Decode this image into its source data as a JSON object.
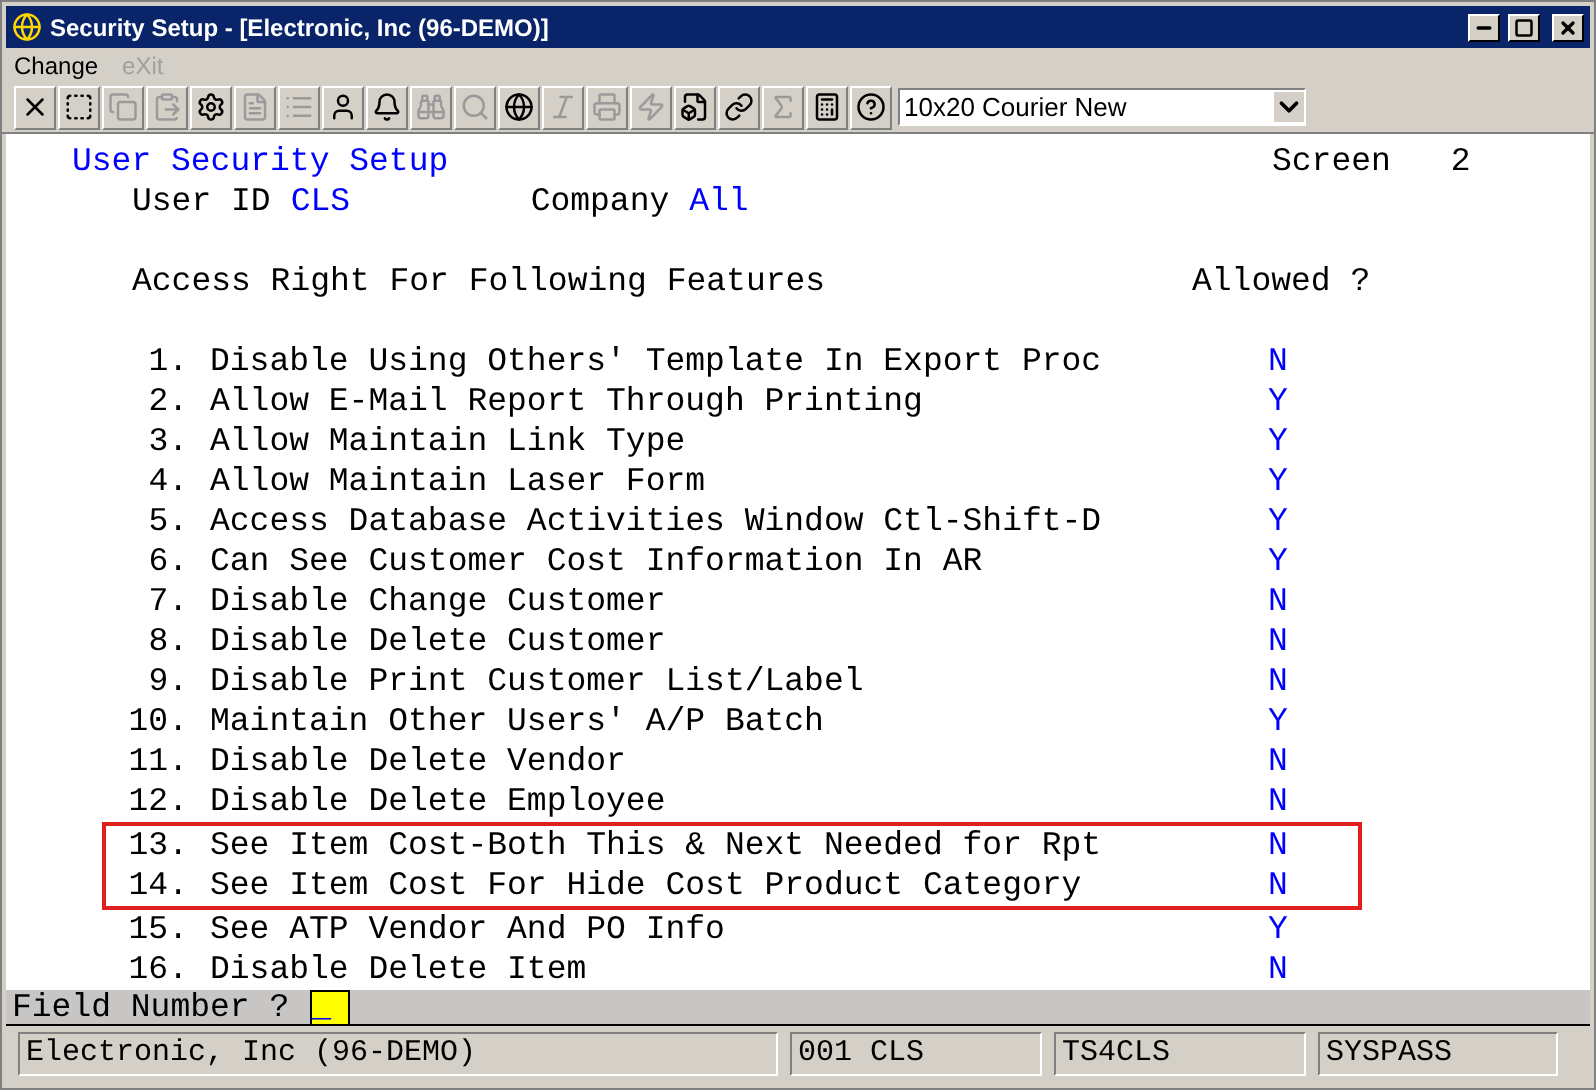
{
  "window": {
    "title": "Security Setup - [Electronic, Inc (96-DEMO)]"
  },
  "menu": [
    {
      "label": "Change",
      "disabled": false
    },
    {
      "label": "eXit",
      "disabled": true
    }
  ],
  "toolbar": {
    "font_select": "10x20 Courier New"
  },
  "screen": {
    "title": "User Security Setup",
    "screen_label": "Screen",
    "screen_number": "2",
    "user_id_label": "User ID",
    "user_id": "CLS",
    "company_label": "Company",
    "company": "All",
    "header": "Access Right For Following Features",
    "allowed_header": "Allowed ?",
    "items": [
      {
        "number": "1.",
        "text": "Disable Using Others' Template In Export Proc",
        "value": "N",
        "highlighted": false
      },
      {
        "number": "2.",
        "text": "Allow E-Mail Report Through Printing",
        "value": "Y",
        "highlighted": false
      },
      {
        "number": "3.",
        "text": "Allow Maintain Link Type",
        "value": "Y",
        "highlighted": false
      },
      {
        "number": "4.",
        "text": "Allow Maintain Laser Form",
        "value": "Y",
        "highlighted": false
      },
      {
        "number": "5.",
        "text": "Access Database Activities Window Ctl-Shift-D",
        "value": "Y",
        "highlighted": false
      },
      {
        "number": "6.",
        "text": "Can See Customer Cost Information In AR",
        "value": "Y",
        "highlighted": false
      },
      {
        "number": "7.",
        "text": "Disable Change Customer",
        "value": "N",
        "highlighted": false
      },
      {
        "number": "8.",
        "text": "Disable Delete Customer",
        "value": "N",
        "highlighted": false
      },
      {
        "number": "9.",
        "text": "Disable Print Customer List/Label",
        "value": "N",
        "highlighted": false
      },
      {
        "number": "10.",
        "text": "Maintain Other Users' A/P Batch",
        "value": "Y",
        "highlighted": false
      },
      {
        "number": "11.",
        "text": "Disable Delete Vendor",
        "value": "N",
        "highlighted": false
      },
      {
        "number": "12.",
        "text": "Disable Delete Employee",
        "value": "N",
        "highlighted": false
      },
      {
        "number": "13.",
        "text": "See Item Cost-Both This & Next Needed for Rpt",
        "value": "N",
        "highlighted": true
      },
      {
        "number": "14.",
        "text": "See Item Cost For Hide Cost Product Category",
        "value": "N",
        "highlighted": true
      },
      {
        "number": "15.",
        "text": "See ATP Vendor And PO Info",
        "value": "Y",
        "highlighted": false
      },
      {
        "number": "16.",
        "text": "Disable Delete Item",
        "value": "N",
        "highlighted": false
      }
    ]
  },
  "prompt": {
    "label": "Field Number ?",
    "value": "_"
  },
  "status_bar": [
    "Electronic, Inc (96-DEMO)",
    "001 CLS",
    "TS4CLS",
    "SYSPASS"
  ]
}
